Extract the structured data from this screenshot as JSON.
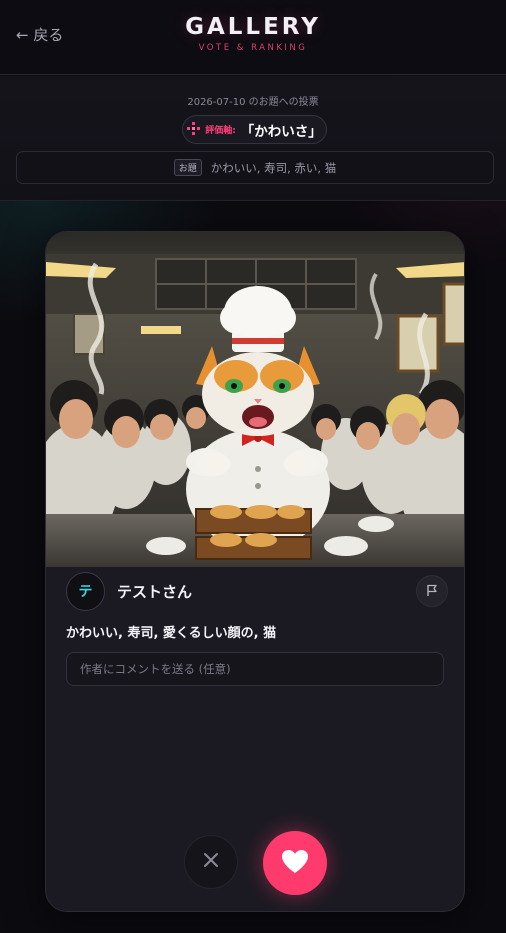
{
  "header": {
    "back_label": "← 戻る",
    "title": "GALLERY",
    "subtitle": "VOTE & RANKING"
  },
  "info": {
    "vote_date": "2026-07-10 のお題への投票",
    "eval_prefix": "評価軸:",
    "eval_value": "「かわいさ」",
    "topic_badge": "お題",
    "topic_text": "かわいい, 寿司, 赤い, 猫"
  },
  "card": {
    "artwork_icon": "cat-chef-artwork",
    "avatar_letter": "テ",
    "author_name": "テストさん",
    "report_icon": "flag-icon",
    "caption": "かわいい, 寿司, 愛くるしい顔の, 猫",
    "comment_placeholder": "作者にコメントを送る (任意)",
    "comment_value": ""
  },
  "actions": {
    "skip_icon": "close-icon",
    "like_icon": "heart-icon"
  },
  "colors": {
    "accent": "#ff3b6e",
    "background": "#0c0b10",
    "card": "#1b1a22",
    "avatar_text": "#3dd6e0"
  }
}
